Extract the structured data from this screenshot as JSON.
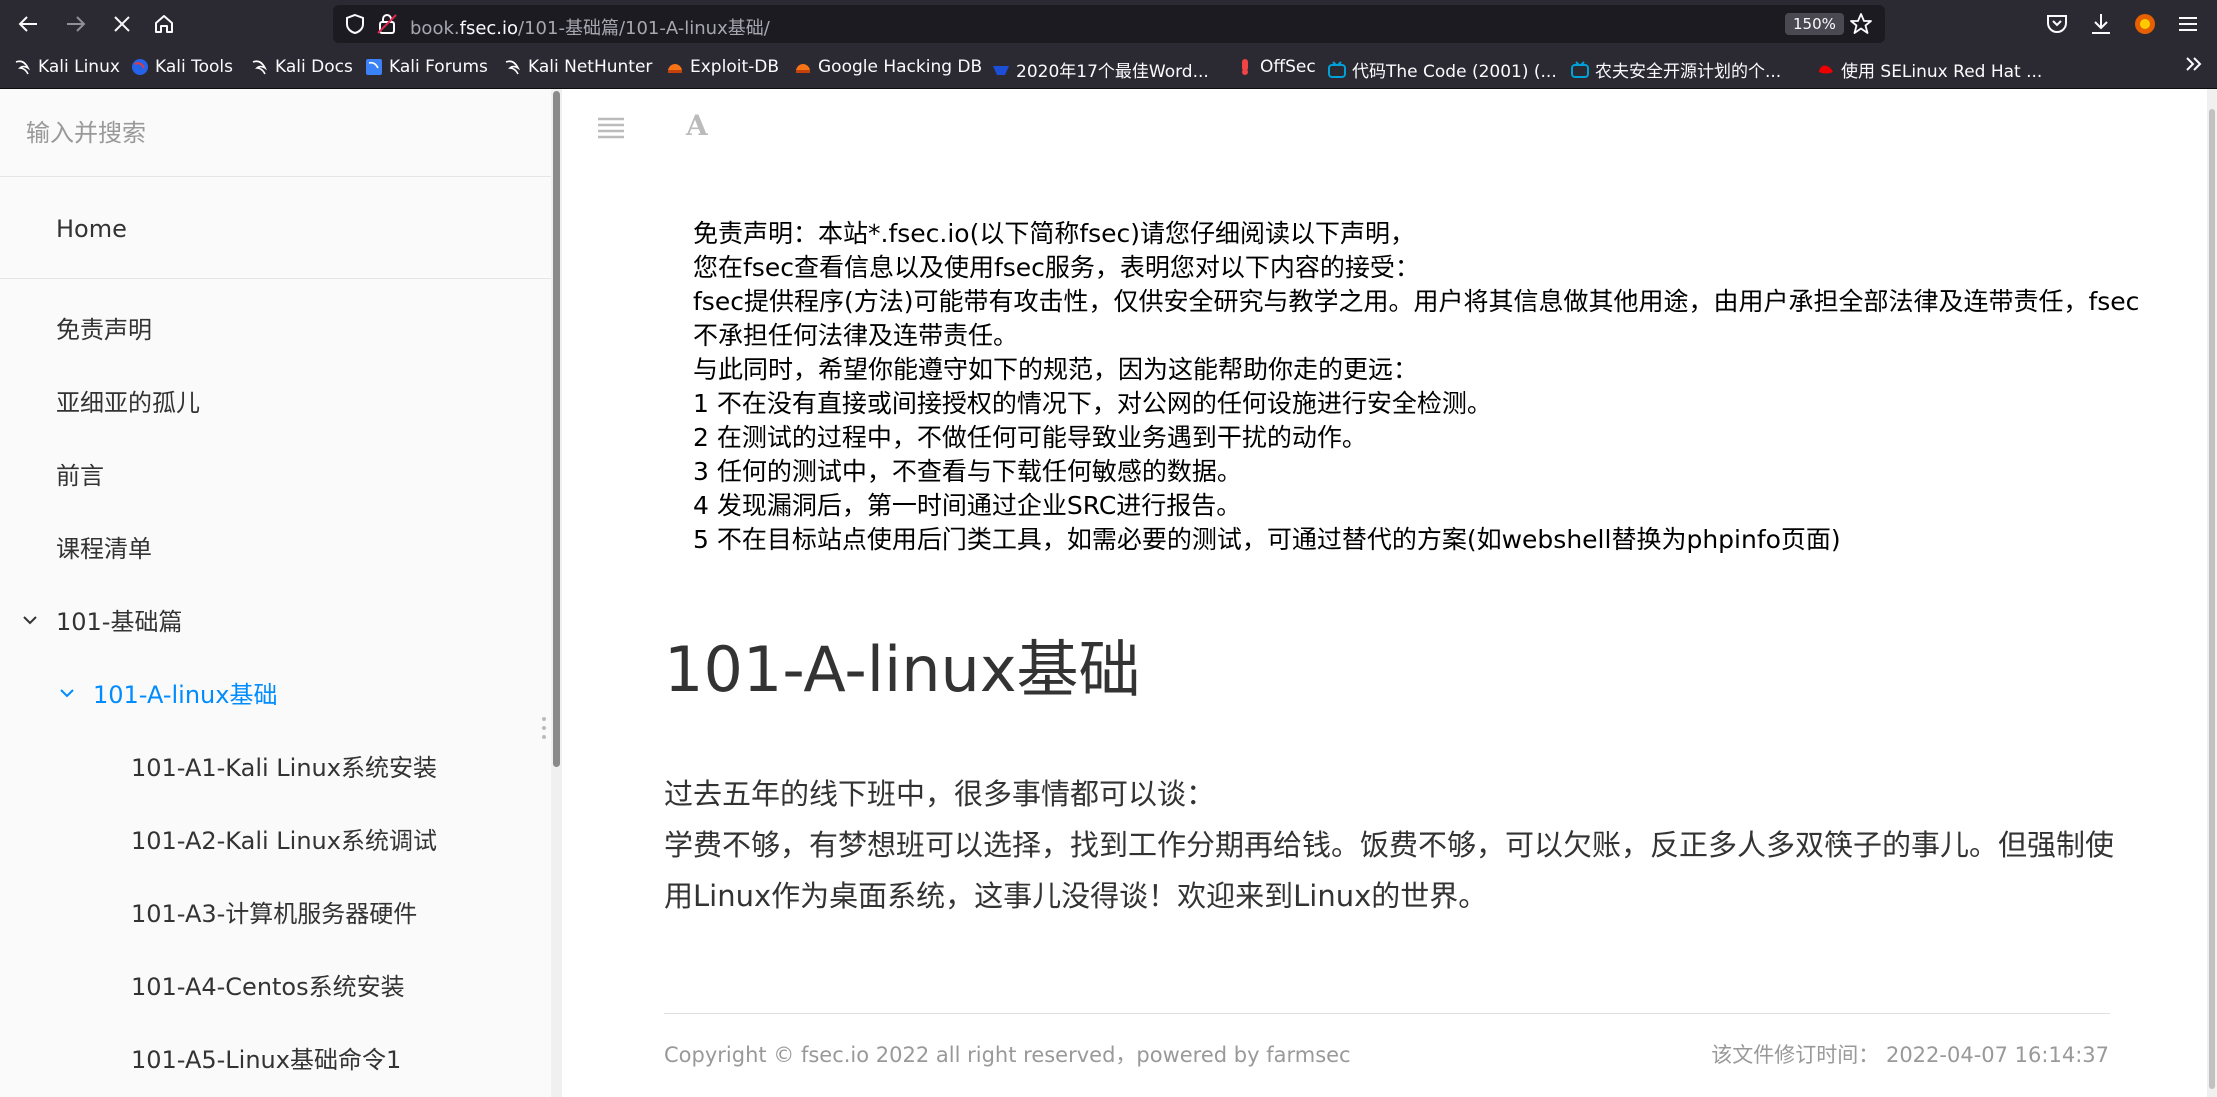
{
  "browser": {
    "url_prefix": "book.",
    "url_host": "fsec.io",
    "url_path": "/101-基础篇/101-A-linux基础/",
    "zoom": "150%"
  },
  "bookmarks": [
    {
      "label": "Kali Linux",
      "icon": "kali-dragon-icon",
      "color": "#ffffff"
    },
    {
      "label": "Kali Tools",
      "icon": "kali-tools-icon",
      "color": "#e23b3b"
    },
    {
      "label": "Kali Docs",
      "icon": "kali-dragon-icon",
      "color": "#ffffff"
    },
    {
      "label": "Kali Forums",
      "icon": "kali-forums-icon",
      "color": "#3b82f6"
    },
    {
      "label": "Kali NetHunter",
      "icon": "kali-dragon-icon",
      "color": "#ffffff"
    },
    {
      "label": "Exploit-DB",
      "icon": "exploit-db-icon",
      "color": "#f97316"
    },
    {
      "label": "Google Hacking DB",
      "icon": "ghdb-icon",
      "color": "#f97316"
    },
    {
      "label": "2020年17个最佳Word...",
      "icon": "blue-site-icon",
      "color": "#1d4ed8"
    },
    {
      "label": "OffSec",
      "icon": "offsec-icon",
      "color": "#ef4444"
    },
    {
      "label": "代码The Code (2001) (...",
      "icon": "bilibili-icon",
      "color": "#00a1d6"
    },
    {
      "label": "农夫安全开源计划的个...",
      "icon": "bilibili-icon",
      "color": "#00a1d6"
    },
    {
      "label": "使用 SELinux Red Hat ...",
      "icon": "redhat-icon",
      "color": "#ee0000"
    }
  ],
  "sidebar": {
    "search_placeholder": "输入并搜索",
    "home": "Home",
    "items": [
      {
        "label": "免责声明"
      },
      {
        "label": "亚细亚的孤儿"
      },
      {
        "label": "前言"
      },
      {
        "label": "课程清单"
      },
      {
        "label": "101-基础篇"
      },
      {
        "label": "101-A-linux基础"
      },
      {
        "label": "101-A1-Kali Linux系统安装"
      },
      {
        "label": "101-A2-Kali Linux系统调试"
      },
      {
        "label": "101-A3-计算机服务器硬件"
      },
      {
        "label": "101-A4-Centos系统安装"
      },
      {
        "label": "101-A5-Linux基础命令1"
      }
    ],
    "active_color": "#008cff"
  },
  "main": {
    "font_button": "A",
    "disclaimer_lines": [
      "免责声明：本站*.fsec.io(以下简称fsec)请您仔细阅读以下声明，",
      "您在fsec查看信息以及使用fsec服务，表明您对以下内容的接受：",
      "fsec提供程序(方法)可能带有攻击性，仅供安全研究与教学之用。用户将其信息做其他用途，由用户承担全部法律及连带责任，fsec不承担任何法律及连带责任。",
      "与此同时，希望你能遵守如下的规范，因为这能帮助你走的更远：",
      "1 不在没有直接或间接授权的情况下，对公网的任何设施进行安全检测。",
      "2 在测试的过程中，不做任何可能导致业务遇到干扰的动作。",
      "3 任何的测试中，不查看与下载任何敏感的数据。",
      "4 发现漏洞后，第一时间通过企业SRC进行报告。",
      "5 不在目标站点使用后门类工具，如需必要的测试，可通过替代的方案(如webshell替换为phpinfo页面)"
    ],
    "title": "101-A-linux基础",
    "paragraph_lines": [
      "过去五年的线下班中，很多事情都可以谈：",
      "学费不够，有梦想班可以选择，找到工作分期再给钱。饭费不够，可以欠账，反正多人多双筷子的事儿。但强制使用Linux作为桌面系统，这事儿没得谈！欢迎来到Linux的世界。"
    ],
    "footer_left": "Copyright © fsec.io 2022 all right reserved，powered by farmsec",
    "footer_right": "该文件修订时间： 2022-04-07 16:14:37"
  }
}
